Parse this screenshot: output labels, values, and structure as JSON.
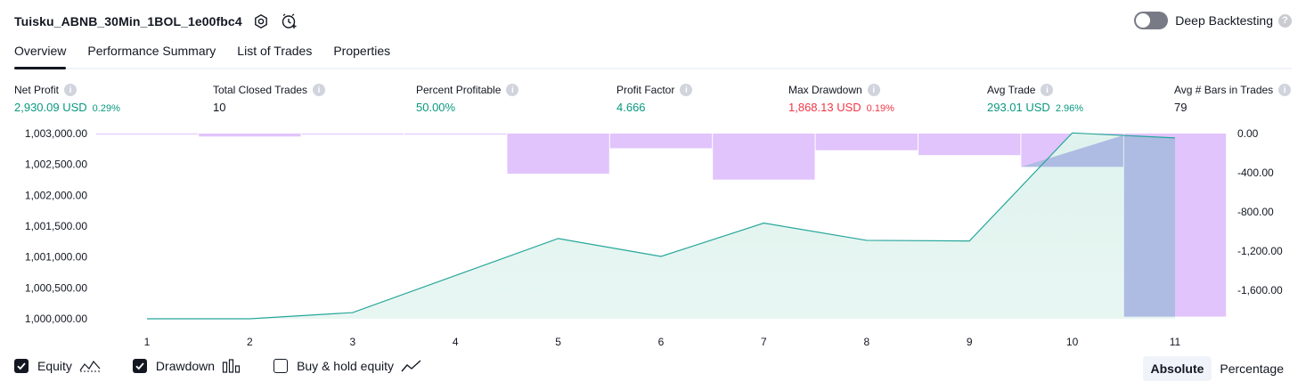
{
  "header": {
    "title": "Tuisku_ABNB_30Min_1BOL_1e00fbc4",
    "deep_backtesting_label": "Deep Backtesting",
    "deep_backtesting_on": false
  },
  "tabs": [
    {
      "label": "Overview",
      "active": true
    },
    {
      "label": "Performance Summary",
      "active": false
    },
    {
      "label": "List of Trades",
      "active": false
    },
    {
      "label": "Properties",
      "active": false
    }
  ],
  "metrics": [
    {
      "label": "Net Profit",
      "value": "2,930.09 USD",
      "pct": "0.29%",
      "color": "green"
    },
    {
      "label": "Total Closed Trades",
      "value": "10",
      "pct": "",
      "color": "dark"
    },
    {
      "label": "Percent Profitable",
      "value": "50.00%",
      "pct": "",
      "color": "green"
    },
    {
      "label": "Profit Factor",
      "value": "4.666",
      "pct": "",
      "color": "green"
    },
    {
      "label": "Max Drawdown",
      "value": "1,868.13 USD",
      "pct": "0.19%",
      "color": "red"
    },
    {
      "label": "Avg Trade",
      "value": "293.01 USD",
      "pct": "2.96%",
      "color": "green"
    },
    {
      "label": "Avg # Bars in Trades",
      "value": "79",
      "pct": "",
      "color": "dark"
    }
  ],
  "chart_data": {
    "type": "area",
    "x": [
      1,
      2,
      3,
      4,
      5,
      6,
      7,
      8,
      9,
      10,
      11
    ],
    "series": [
      {
        "name": "Equity",
        "type": "area",
        "axis": "left",
        "values": [
          1000000,
          1000000,
          1000100,
          1000700,
          1001300,
          1001010,
          1001550,
          1001270,
          1001260,
          1003010,
          1002930
        ]
      },
      {
        "name": "Drawdown",
        "type": "bar",
        "axis": "right",
        "values": [
          0,
          -30,
          -5,
          0,
          -410,
          -150,
          -470,
          -170,
          -220,
          -340,
          -1868.13
        ]
      }
    ],
    "left_axis": {
      "ticks": [
        "1,003,000.00",
        "1,002,500.00",
        "1,002,000.00",
        "1,001,500.00",
        "1,001,000.00",
        "1,000,500.00",
        "1,000,000.00"
      ],
      "min": 1000000,
      "max": 1003000
    },
    "right_axis": {
      "ticks": [
        "0.00",
        "-400.00",
        "-800.00",
        "-1,200.00",
        "-1,600.00"
      ],
      "min": -1890,
      "max": 0
    },
    "x_ticks": [
      "1",
      "2",
      "3",
      "4",
      "5",
      "6",
      "7",
      "8",
      "9",
      "10",
      "11"
    ],
    "colors": {
      "equity_line": "#26a69a",
      "equity_fill": "#e0f3ee",
      "drawdown": "#e1c4fc",
      "overlap": "#aebbe2"
    }
  },
  "legend": {
    "items": [
      {
        "label": "Equity",
        "checked": true,
        "icon": "equity-line-icon"
      },
      {
        "label": "Drawdown",
        "checked": true,
        "icon": "drawdown-bars-icon"
      },
      {
        "label": "Buy & hold equity",
        "checked": false,
        "icon": "buy-hold-line-icon"
      }
    ]
  },
  "view_modes": [
    {
      "label": "Absolute",
      "active": true
    },
    {
      "label": "Percentage",
      "active": false
    }
  ]
}
